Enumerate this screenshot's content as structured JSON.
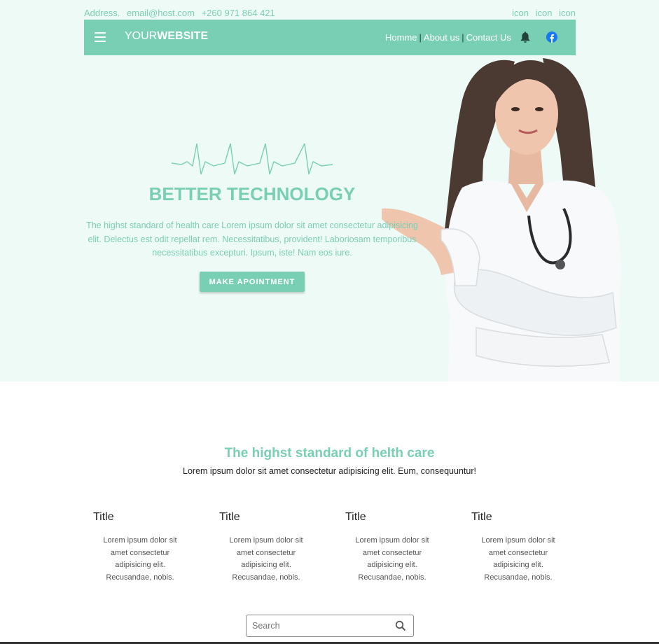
{
  "topbar": {
    "address": "Address.",
    "email": "email@host.com",
    "phone": "+260 971 864 421",
    "icons": [
      "icon",
      "icon",
      "icon"
    ]
  },
  "navbar": {
    "brand_light": "YOUR",
    "brand_bold": "WEBSITE",
    "links": [
      "Homme",
      "About us",
      "Contact Us"
    ],
    "separator": "|"
  },
  "hero": {
    "title": "BETTER TECHNOLOGY",
    "description": "The highst standard of health care Lorem ipsum dolor sit amet consectetur adipisicing elit. Delectus est odit repellat rem. Necessitatibus, provident! Laboriosam temporibus necessitatibus excepturi. Ipsum, iste! Nam eos iure.",
    "cta": "MAKE APOINTMENT"
  },
  "features": {
    "title": "The highst standard of helth care",
    "subtitle": "Lorem ipsum dolor sit amet consectetur adipisicing elit. Eum, consequuntur!",
    "cards": [
      {
        "title": "Title",
        "text": "Lorem ipsum dolor sit amet consectetur adipisicing elit. Recusandae, nobis."
      },
      {
        "title": "Title",
        "text": "Lorem ipsum dolor sit amet consectetur adipisicing elit. Recusandae, nobis."
      },
      {
        "title": "Title",
        "text": "Lorem ipsum dolor sit amet consectetur adipisicing elit. Recusandae, nobis."
      },
      {
        "title": "Title",
        "text": "Lorem ipsum dolor sit amet consectetur adipisicing elit. Recusandae, nobis."
      }
    ]
  },
  "search": {
    "placeholder": "Search"
  },
  "colors": {
    "accent": "#79cfb4",
    "hero_bg": "#eefaf6",
    "facebook": "#1877f2",
    "bell": "#24433a"
  }
}
